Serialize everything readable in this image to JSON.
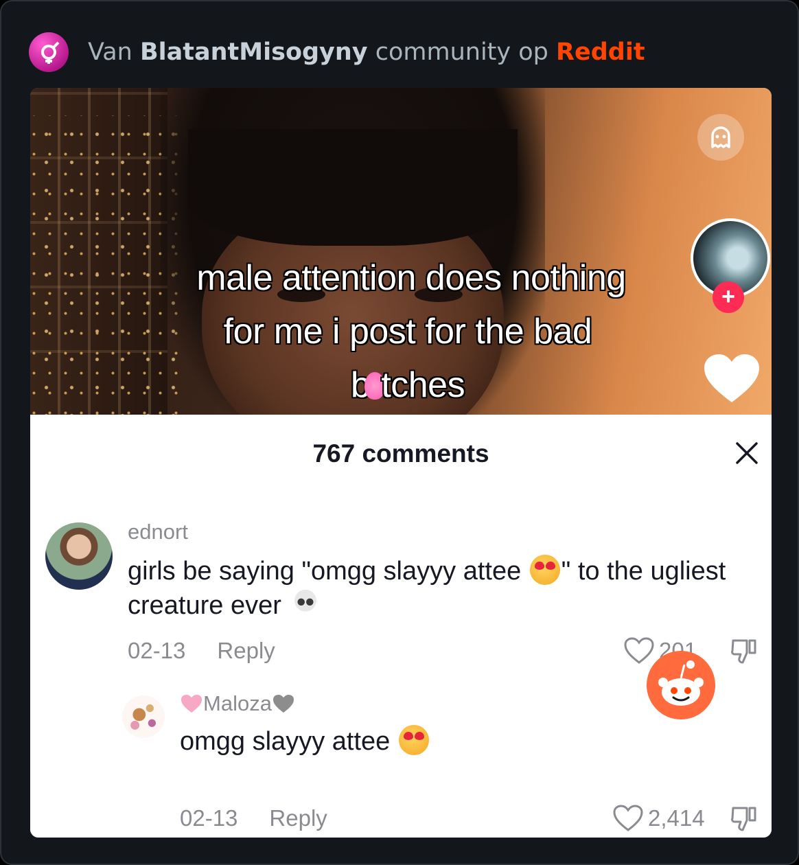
{
  "header": {
    "prefix": "Van",
    "community": "BlatantMisogyny",
    "middle": "community op",
    "brand": "Reddit",
    "brand_color": "#ff4500"
  },
  "video": {
    "overlay_line1": "male attention does nothing",
    "overlay_line2": "for me i post for the bad",
    "overlay_line3_start": "b",
    "overlay_line3_end": "tches",
    "icons": [
      "ghost-icon",
      "profile-avatar",
      "follow-plus-icon",
      "like-heart-icon"
    ],
    "follow_label": "+"
  },
  "comments_sheet": {
    "title": "767 comments",
    "close_icon": "close-icon",
    "comments": [
      {
        "username": "ednort",
        "text_part1": "girls be saying \"omgg slayyy attee ",
        "text_part2": "\" to the ugliest creature ever ",
        "date": "02-13",
        "reply_label": "Reply",
        "likes": "201"
      },
      {
        "username": "Maloza",
        "text": "omgg slayyy attee ",
        "date": "02-13",
        "reply_label": "Reply",
        "likes": "2,414"
      }
    ]
  },
  "colors": {
    "tiktok_red": "#fe2c55",
    "background": "#13171c",
    "reddit_orange": "#ff4500"
  }
}
